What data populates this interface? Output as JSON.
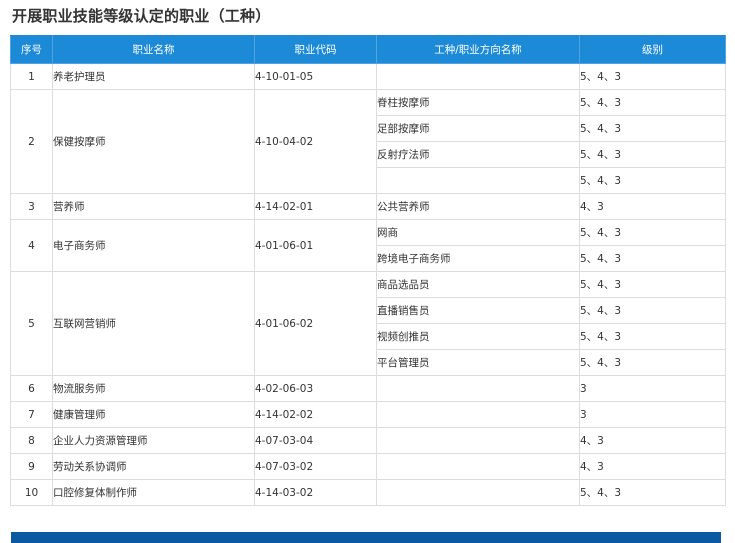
{
  "page_title": "开展职业技能等级认定的职业（工种）",
  "table": {
    "headers": {
      "no": "序号",
      "name": "职业名称",
      "code": "职业代码",
      "subtype": "工种/职业方向名称",
      "level": "级别"
    },
    "groups": [
      {
        "no": "1",
        "name": "养老护理员",
        "code": "4-10-01-05",
        "subs": [
          {
            "sub": "",
            "level": "5、4、3"
          }
        ]
      },
      {
        "no": "2",
        "name": "保健按摩师",
        "code": "4-10-04-02",
        "subs": [
          {
            "sub": "脊柱按摩师",
            "level": "5、4、3"
          },
          {
            "sub": "足部按摩师",
            "level": "5、4、3"
          },
          {
            "sub": "反射疗法师",
            "level": "5、4、3"
          },
          {
            "sub": "",
            "level": "5、4、3"
          }
        ]
      },
      {
        "no": "3",
        "name": "营养师",
        "code": "4-14-02-01",
        "subs": [
          {
            "sub": "公共营养师",
            "level": "4、3"
          }
        ]
      },
      {
        "no": "4",
        "name": "电子商务师",
        "code": "4-01-06-01",
        "subs": [
          {
            "sub": "网商",
            "level": "5、4、3"
          },
          {
            "sub": "跨境电子商务师",
            "level": "5、4、3"
          }
        ]
      },
      {
        "no": "5",
        "name": "互联网营销师",
        "code": "4-01-06-02",
        "subs": [
          {
            "sub": "商品选品员",
            "level": "5、4、3"
          },
          {
            "sub": "直播销售员",
            "level": "5、4、3"
          },
          {
            "sub": "视频创推员",
            "level": "5、4、3"
          },
          {
            "sub": "平台管理员",
            "level": "5、4、3"
          }
        ]
      },
      {
        "no": "6",
        "name": "物流服务师",
        "code": "4-02-06-03",
        "subs": [
          {
            "sub": "",
            "level": "3"
          }
        ]
      },
      {
        "no": "7",
        "name": "健康管理师",
        "code": "4-14-02-02",
        "subs": [
          {
            "sub": "",
            "level": "3"
          }
        ]
      },
      {
        "no": "8",
        "name": "企业人力资源管理师",
        "code": "4-07-03-04",
        "subs": [
          {
            "sub": "",
            "level": "4、3"
          }
        ]
      },
      {
        "no": "9",
        "name": "劳动关系协调师",
        "code": "4-07-03-02",
        "subs": [
          {
            "sub": "",
            "level": "4、3"
          }
        ]
      },
      {
        "no": "10",
        "name": "口腔修复体制作师",
        "code": "4-14-03-02",
        "subs": [
          {
            "sub": "",
            "level": "5、4、3"
          }
        ]
      }
    ]
  },
  "colors": {
    "header_bg": "#1c8ad7",
    "bottom_bar": "#0b5aa1",
    "border": "#dcdcdc"
  }
}
